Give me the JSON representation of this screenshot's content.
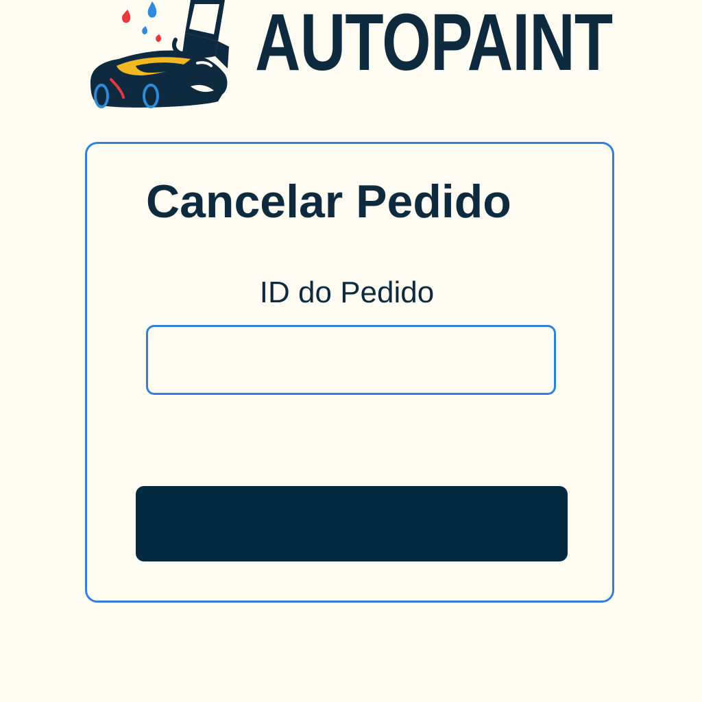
{
  "brand": {
    "name": "AUTOPAINT",
    "logo_icon": "car-paint-spray-icon"
  },
  "form": {
    "title": "Cancelar Pedido",
    "order_id_label": "ID do Pedido",
    "order_id_value": "",
    "order_id_placeholder": "",
    "submit_label": ""
  },
  "colors": {
    "background": "#fffdf3",
    "primary_text": "#0d2a3f",
    "accent_border": "#2f7fe0",
    "button": "#032a40",
    "car_stripe": "#f2b824",
    "paint_red": "#e8383d",
    "paint_blue": "#2e8bd8"
  }
}
